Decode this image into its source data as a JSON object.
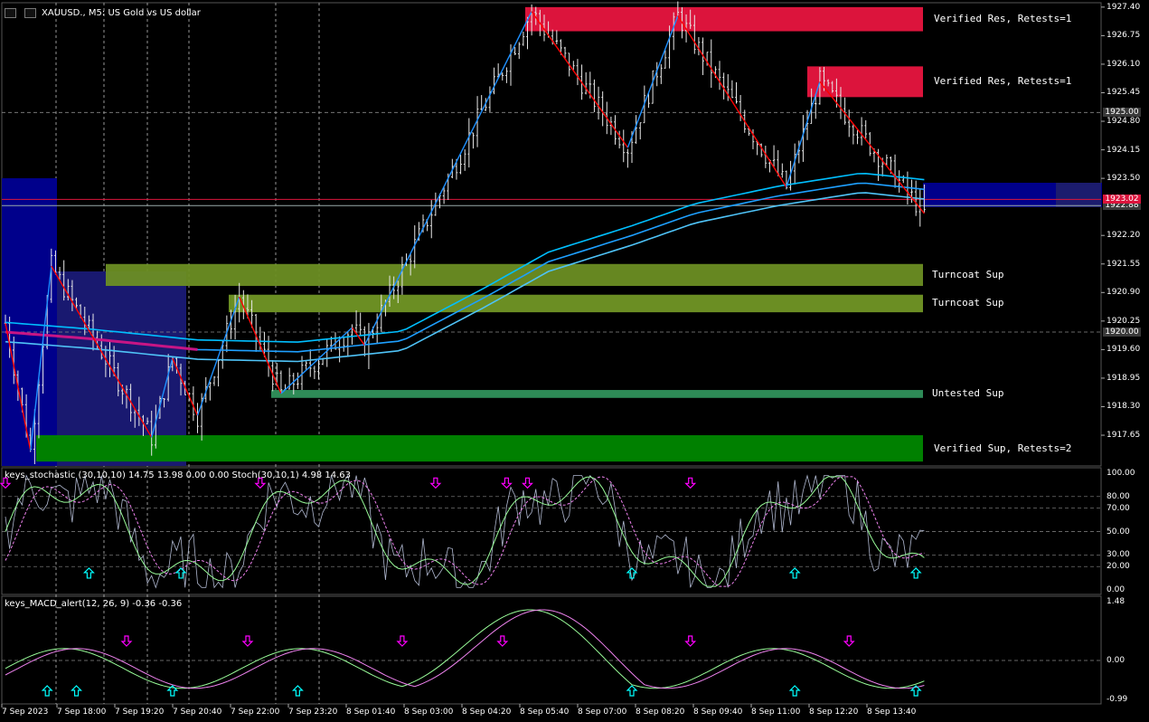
{
  "header": {
    "symbol_title": "XAUUSD., M5:  US Gold vs US dollar"
  },
  "icons": [
    "trade-panel-icon",
    "depth-of-market-icon"
  ],
  "colors": {
    "background": "#000000",
    "resistance_zone": "#dc143c",
    "turncoat_support_zone": "#6b8e23",
    "untested_support_zone": "#2e8b57",
    "verified_support_zone": "#008000",
    "zigzag_up": "#1e90ff",
    "zigzag_down": "#ff0000",
    "moving_average": "#00bfff",
    "current_range_box": "#00008b"
  },
  "zones": [
    {
      "label": "Verified Res, Retests=1",
      "from": 1926.85,
      "to": 1927.4,
      "kind": "resistance"
    },
    {
      "label": "Verified Res, Retests=1",
      "from": 1925.35,
      "to": 1926.05,
      "kind": "resistance"
    },
    {
      "label": "Turncoat Sup",
      "from": 1921.05,
      "to": 1921.55,
      "kind": "turncoat"
    },
    {
      "label": "Turncoat Sup",
      "from": 1920.45,
      "to": 1920.85,
      "kind": "turncoat"
    },
    {
      "label": "Untested Sup",
      "from": 1918.5,
      "to": 1918.68,
      "kind": "untested"
    },
    {
      "label": "Verified Sup, Retests=2",
      "from": 1917.05,
      "to": 1917.65,
      "kind": "verified_support"
    }
  ],
  "price_axis": {
    "ticks": [
      "1927.40",
      "1926.75",
      "1926.10",
      "1925.45",
      "1924.80",
      "1924.15",
      "1923.50",
      "1922.20",
      "1921.55",
      "1920.90",
      "1920.25",
      "1919.60",
      "1918.95",
      "1918.30",
      "1917.65"
    ],
    "badges": [
      {
        "text": "1925.00",
        "price": 1925.0,
        "bg": "#3a3a3a",
        "fg": "#ffffff"
      },
      {
        "text": "1920.00",
        "price": 1920.0,
        "bg": "#3a3a3a",
        "fg": "#ffffff"
      },
      {
        "text": "1922.88",
        "price": 1922.88,
        "bg": "#3a3a3a",
        "fg": "#ffffff"
      },
      {
        "text": "1923.02",
        "price": 1923.02,
        "bg": "#dc143c",
        "fg": "#ffffff"
      }
    ]
  },
  "price_chart": {
    "ylim": [
      1916.95,
      1927.5
    ],
    "ask_line": 1923.02,
    "bid_line": 1922.88,
    "zigzag": [
      {
        "t": 0,
        "p": 1920.2
      },
      {
        "t": 6,
        "p": 1917.3
      },
      {
        "t": 11,
        "p": 1921.5
      },
      {
        "t": 35,
        "p": 1917.6
      },
      {
        "t": 40,
        "p": 1919.4
      },
      {
        "t": 46,
        "p": 1918.1
      },
      {
        "t": 56,
        "p": 1920.8
      },
      {
        "t": 66,
        "p": 1918.6
      },
      {
        "t": 83,
        "p": 1920.1
      },
      {
        "t": 86,
        "p": 1919.7
      },
      {
        "t": 126,
        "p": 1927.3
      },
      {
        "t": 149,
        "p": 1924.2
      },
      {
        "t": 161,
        "p": 1927.2
      },
      {
        "t": 187,
        "p": 1923.3
      },
      {
        "t": 195,
        "p": 1925.7
      },
      {
        "t": 220,
        "p": 1922.7
      }
    ],
    "moving_average": [
      {
        "t": 0,
        "p": 1920.0
      },
      {
        "t": 20,
        "p": 1919.85
      },
      {
        "t": 46,
        "p": 1919.6
      },
      {
        "t": 70,
        "p": 1919.55
      },
      {
        "t": 95,
        "p": 1919.8
      },
      {
        "t": 115,
        "p": 1920.8
      },
      {
        "t": 130,
        "p": 1921.6
      },
      {
        "t": 150,
        "p": 1922.2
      },
      {
        "t": 165,
        "p": 1922.7
      },
      {
        "t": 185,
        "p": 1923.1
      },
      {
        "t": 205,
        "p": 1923.4
      },
      {
        "t": 220,
        "p": 1923.25
      }
    ]
  },
  "stochastic_panel": {
    "title": "keys_stochastic (30,10,10) 14.75 13.98 0.00 0.00 Stoch(30,10,1) 4.98 14.63",
    "ticks": [
      "100.00",
      "80.00",
      "70.00",
      "50.00",
      "30.00",
      "20.00",
      "0.00"
    ],
    "levels": [
      80,
      70,
      50,
      30,
      20
    ]
  },
  "macd_panel": {
    "title": "keys_MACD_alert(12, 26, 9) -0.36 -0.36",
    "ticks": [
      "1.48",
      "0.00",
      "-0.99"
    ]
  },
  "time_axis": {
    "ticks": [
      "7 Sep 2023",
      "7 Sep 18:00",
      "7 Sep 19:20",
      "7 Sep 20:40",
      "7 Sep 22:00",
      "7 Sep 23:20",
      "8 Sep 01:40",
      "8 Sep 03:00",
      "8 Sep 04:20",
      "8 Sep 05:40",
      "8 Sep 07:00",
      "8 Sep 08:20",
      "8 Sep 09:40",
      "8 Sep 11:00",
      "8 Sep 12:20",
      "8 Sep 13:40"
    ]
  }
}
